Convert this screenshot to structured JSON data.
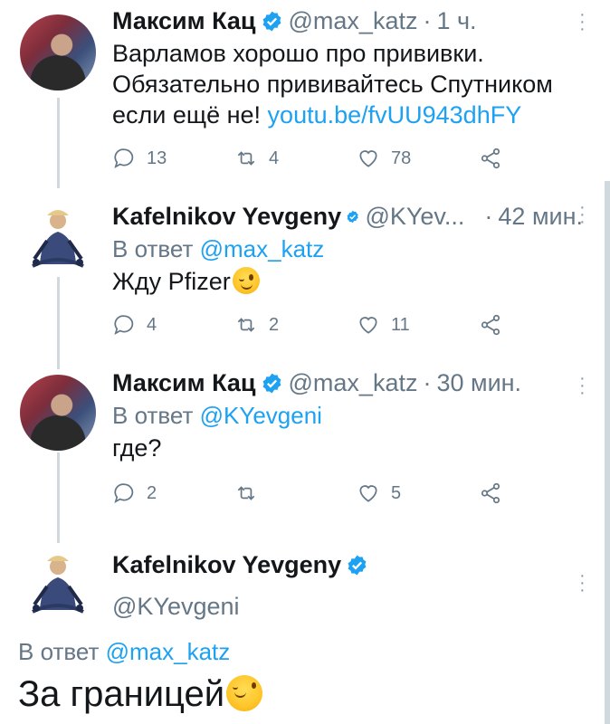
{
  "tweets": [
    {
      "name": "Максим Кац",
      "handle": "@max_katz",
      "dot": "·",
      "time": "1 ч.",
      "text_line1": "Варламов хорошо про прививки.",
      "text_line2": "Обязательно прививайтесь Спутником",
      "text_line3_prefix": "если ещё не! ",
      "link": "youtu.be/fvUU943dhFY",
      "replies": "13",
      "retweets": "4",
      "likes": "78"
    },
    {
      "name": "Kafelnikov Yevgeny",
      "handle": "@KYev...",
      "dot": "·",
      "time": "42 мин.",
      "reply_prefix": "В ответ ",
      "reply_to": "@max_katz",
      "text": "Жду Pfizer",
      "replies": "4",
      "retweets": "2",
      "likes": "11"
    },
    {
      "name": "Максим Кац",
      "handle": "@max_katz",
      "dot": "·",
      "time": "30 мин.",
      "reply_prefix": "В ответ ",
      "reply_to": "@KYevgeni",
      "text": "где?",
      "replies": "2",
      "retweets": "",
      "likes": "5"
    },
    {
      "name": "Kafelnikov Yevgeny",
      "handle": "@KYevgeni",
      "reply_prefix": "В ответ ",
      "reply_to": "@max_katz",
      "text": "За границей"
    }
  ],
  "colors": {
    "link": "#1da1f2",
    "muted": "#657786",
    "text": "#14171a",
    "verified": "#1da1f2"
  },
  "icons": {
    "reply": "reply-icon",
    "retweet": "retweet-icon",
    "like": "heart-icon",
    "share": "share-icon",
    "verified": "verified-badge-icon",
    "more": "more-vertical-icon",
    "emoji": "winking-face-emoji"
  }
}
